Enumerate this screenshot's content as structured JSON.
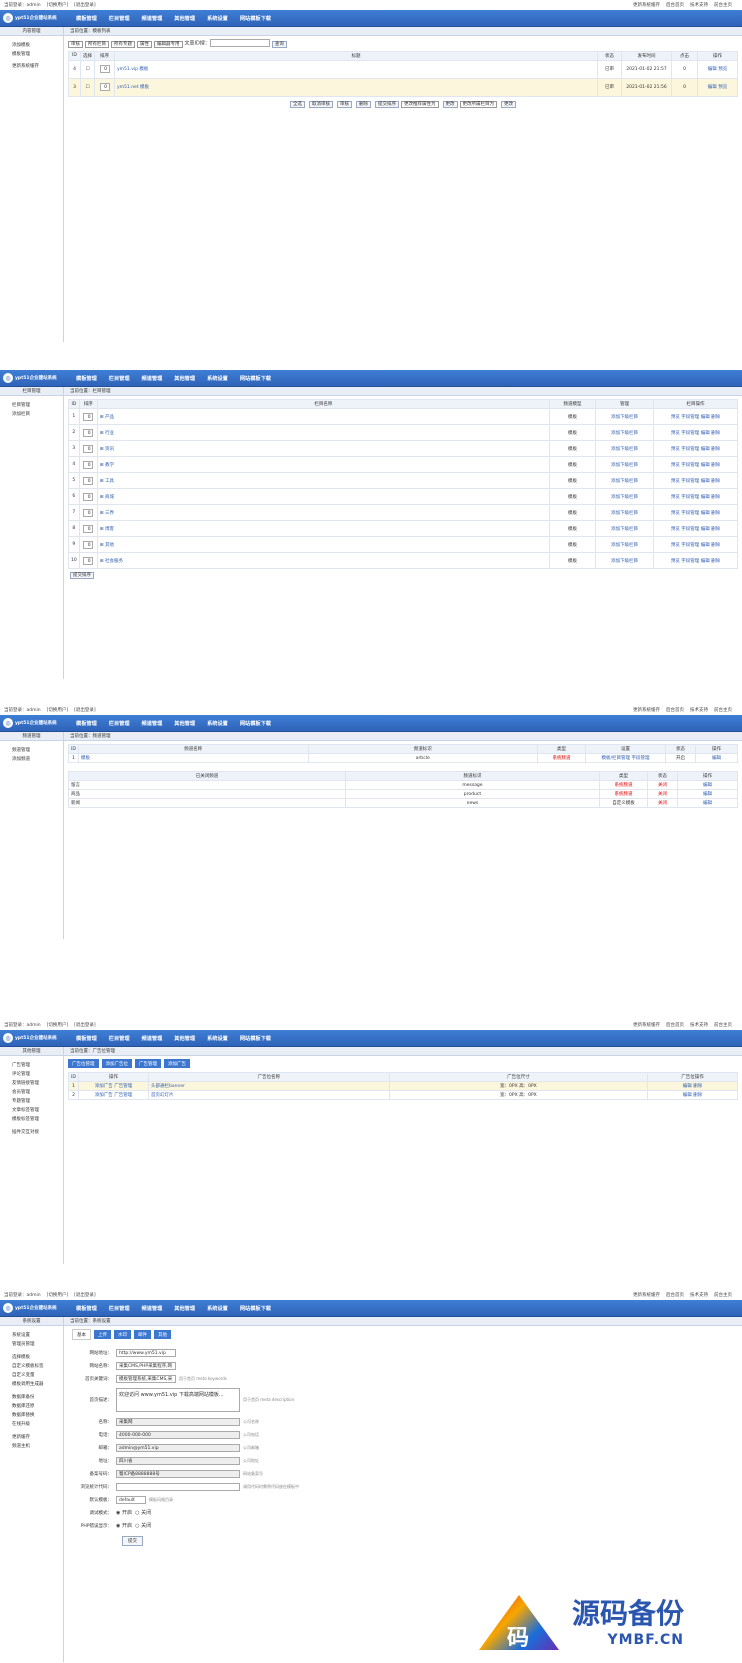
{
  "topbar": {
    "user": "当前登录：admin",
    "switch": "[切换用户]",
    "logout": "[退出登录]",
    "right_links": [
      "更新系统缓存",
      "后台首页",
      "技术支持",
      "前台主页"
    ]
  },
  "logo_text": "ypt51企业建站系统",
  "nav": [
    "模板管理",
    "栏目管理",
    "频道管理",
    "其他管理",
    "系统设置",
    "网站模板下载"
  ],
  "s1": {
    "side_title": "内容管理",
    "crumb": "当前位置：模板列表",
    "side": [
      "添加模板",
      "模板管理",
      "更新系统缓存"
    ],
    "filters": [
      "审核",
      "所有栏目",
      "所有专题",
      "属性",
      "编辑器专用",
      "文章ID搜：",
      "查询"
    ],
    "headers": [
      "ID",
      "选择",
      "排序",
      "标题",
      "状态",
      "发布时间",
      "点击",
      "操作"
    ],
    "rows": [
      {
        "id": "4",
        "sort": "0",
        "title": "ym51.vip 模板",
        "status": "已审",
        "time": "2021-01-02 21:57",
        "hits": "0",
        "ops": [
          "编辑",
          "预览"
        ]
      },
      {
        "id": "3",
        "sort": "0",
        "title": "ym51.net 模板",
        "status": "已审",
        "time": "2021-01-02 21:56",
        "hits": "0",
        "ops": [
          "编辑",
          "预览"
        ]
      }
    ],
    "buttons": [
      "全选",
      "取消审核",
      "审核",
      "删除",
      "提交排序"
    ],
    "sel1": "更改推荐属性为",
    "btn_change1": "更改",
    "sel2": "更改所属栏目为",
    "btn_change2": "更改"
  },
  "s2": {
    "side_title": "栏目管理",
    "crumb": "当前位置：栏目管理",
    "side": [
      "栏目管理",
      "添加栏目"
    ],
    "headers": [
      "ID",
      "排序",
      "栏目名称",
      "频道模型",
      "管理",
      "栏目操作"
    ],
    "rows": [
      {
        "id": "1",
        "sort": "0",
        "name": "产品"
      },
      {
        "id": "2",
        "sort": "0",
        "name": "行业"
      },
      {
        "id": "3",
        "sort": "0",
        "name": "资讯"
      },
      {
        "id": "4",
        "sort": "0",
        "name": "教学"
      },
      {
        "id": "5",
        "sort": "0",
        "name": "工具"
      },
      {
        "id": "6",
        "sort": "0",
        "name": "商城"
      },
      {
        "id": "7",
        "sort": "0",
        "name": "三界"
      },
      {
        "id": "8",
        "sort": "0",
        "name": "博客"
      },
      {
        "id": "9",
        "sort": "0",
        "name": "其他"
      },
      {
        "id": "10",
        "sort": "0",
        "name": "社会服务"
      }
    ],
    "model": "模板",
    "manage": "添加下级栏目",
    "ops": [
      "预览",
      "字段管理",
      "编辑",
      "删除"
    ],
    "submit": "提交排序"
  },
  "s3": {
    "side_title": "频道管理",
    "crumb": "当前位置：频道管理",
    "side": [
      "频道管理",
      "添加频道"
    ],
    "headers1": [
      "ID",
      "频道名称",
      "频道标识",
      "类型",
      "设置",
      "状态",
      "操作"
    ],
    "row1": {
      "id": "1",
      "name": "模板",
      "ident": "article",
      "type": "系统频道",
      "set": [
        "模板/栏目管理",
        "字段管理"
      ],
      "state": "开启",
      "op": "编辑"
    },
    "headers2": [
      "已关闭频道",
      "频道标识",
      "类型",
      "状态",
      "操作"
    ],
    "rows2": [
      {
        "name": "留言",
        "ident": "message",
        "type": "系统频道",
        "state": "关闭",
        "op": "编辑"
      },
      {
        "name": "商品",
        "ident": "product",
        "type": "系统频道",
        "state": "关闭",
        "op": "编辑"
      },
      {
        "name": "新闻",
        "ident": "news",
        "type": "自定义模板",
        "state": "关闭",
        "op": "编辑"
      }
    ]
  },
  "s4": {
    "side_title": "其他管理",
    "crumb": "当前位置：广告位管理",
    "side": [
      "广告管理",
      "评论管理",
      "友情链接管理",
      "会员管理",
      "专题管理",
      "文章标签管理",
      "模板标签管理",
      "插件交互对接"
    ],
    "tabs": [
      "广告位管理",
      "添加广告位",
      "广告管理",
      "添加广告"
    ],
    "headers": [
      "ID",
      "操作",
      "广告位名称",
      "广告位尺寸",
      "广告位操作"
    ],
    "rows": [
      {
        "id": "1",
        "a": "添加广告",
        "b": "广告管理",
        "name": "头部通栏banner",
        "size": "宽：0PX 高：0PX",
        "ops": [
          "编辑",
          "删除"
        ]
      },
      {
        "id": "2",
        "a": "添加广告",
        "b": "广告管理",
        "name": "首页幻灯片",
        "size": "宽：0PX 高：0PX",
        "ops": [
          "编辑",
          "删除"
        ]
      }
    ]
  },
  "s5": {
    "side_title": "系统设置",
    "crumb": "当前位置：系统设置",
    "side": [
      "系统设置",
      "管理员管理",
      "选择模板",
      "自定义模板标签",
      "自定义变量",
      "模板调用生成器",
      "数据库备份",
      "数据库还原",
      "数据库替换",
      "在线升级",
      "更新缓存",
      "频道主机"
    ],
    "tabs": [
      "基本",
      "上传",
      "水印",
      "邮件",
      "其他"
    ],
    "fields": [
      {
        "label": "网站地址：",
        "value": "http://www.ym51.vip",
        "hint": ""
      },
      {
        "label": "网站名称：",
        "value": "采集CMS,PHP采集程序,网",
        "hint": ""
      },
      {
        "label": "首页关键词：",
        "value": "模板管理系统,采集CMS,采",
        "hint": "用于首页 meta keywords"
      },
      {
        "label": "首页描述：",
        "value": "欢迎访问 www.ym51.vip 下载高端网站模板...",
        "hint": "用于首页 meta description"
      },
      {
        "label": "名称：",
        "value": "采集网",
        "hint": "公司名称"
      },
      {
        "label": "电话：",
        "value": "4000-000-000",
        "hint": "公司电话"
      },
      {
        "label": "邮箱：",
        "value": "admin@ym51.vip",
        "hint": "公司邮箱"
      },
      {
        "label": "地址：",
        "value": "四川省",
        "hint": "公司地址"
      },
      {
        "label": "备案号码：",
        "value": "蜀ICP备8888888号",
        "hint": "网站备案号"
      },
      {
        "label": "浏览统计代码：",
        "value": "",
        "hint": "调用代码时需将代码放在模板中"
      },
      {
        "label": "默认模板：",
        "value": "default",
        "hint": "模板风格目录"
      },
      {
        "label": "调试模式：",
        "radio": [
          "开启",
          "关闭"
        ],
        "hint": ""
      },
      {
        "label": "PHP错误显示：",
        "radio": [
          "开启",
          "关闭"
        ],
        "hint": ""
      }
    ],
    "submit": "提交"
  },
  "watermark": {
    "cn": "源码备份",
    "en": "YMBF.CN",
    "mark": "码"
  }
}
